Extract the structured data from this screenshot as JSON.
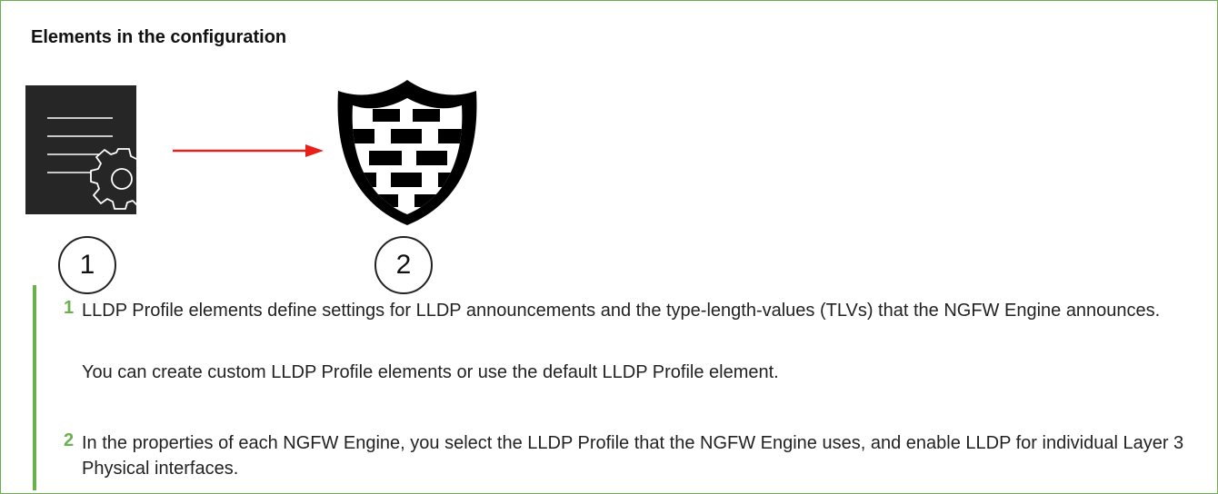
{
  "title": "Elements in the configuration",
  "colors": {
    "accent_green": "#6ab04c",
    "arrow_red": "#e8201a",
    "icon_dark": "#262626"
  },
  "icons": {
    "element_1": "lldp-profile-document-gear-icon",
    "element_2": "ngfw-engine-firewall-shield-icon"
  },
  "callouts": [
    "1",
    "2"
  ],
  "legend": [
    {
      "number": "1",
      "text": "LLDP Profile elements define settings for LLDP announcements and the type-length-values (TLVs) that the NGFW Engine announces.",
      "note": "You can create custom LLDP Profile elements or use the default LLDP Profile element."
    },
    {
      "number": "2",
      "text": "In the properties of each NGFW Engine, you select the LLDP Profile that the NGFW Engine uses, and enable LLDP for individual Layer 3 Physical interfaces."
    }
  ]
}
